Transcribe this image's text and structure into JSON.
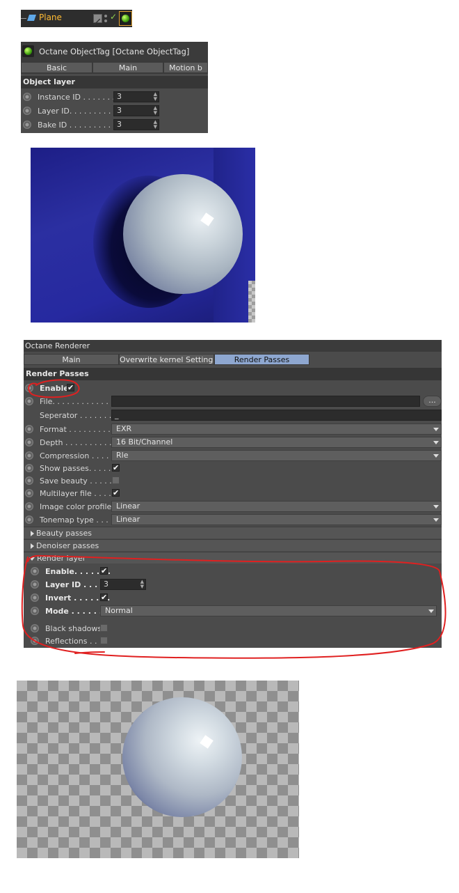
{
  "object_manager": {
    "object_name": "Plane",
    "icons": [
      "plane-icon",
      "phong-tag-icon",
      "visibility-dots-icon",
      "enabled-check-icon",
      "octane-tag-icon"
    ],
    "check_glyph": "✓"
  },
  "object_tag": {
    "title": "Octane ObjectTag [Octane ObjectTag]",
    "tabs": [
      "Basic",
      "Main",
      "Motion b"
    ],
    "section": "Object layer",
    "fields": [
      {
        "label": "Instance ID . . . . . . . .",
        "value": "3"
      },
      {
        "label": "Layer ID. . . . . . . . . . .",
        "value": "3"
      },
      {
        "label": "Bake ID . . . . . . . . . . .",
        "value": "3"
      }
    ]
  },
  "octane_renderer": {
    "title": "Octane Renderer",
    "tabs": [
      "Main",
      "Overwrite kernel Settings",
      "Render Passes"
    ],
    "active_tab": "Render Passes",
    "section": "Render Passes",
    "enable_label": "Enable",
    "file_label": "File. . . . . . . . . . . . . .",
    "file_value": "",
    "file_button": "...",
    "separator_label": "Seperator . . . . . . . .",
    "separator_value": "_",
    "format_label": "Format . . . . . . . . . . .",
    "format_value": "EXR",
    "depth_label": "Depth . . . . . . . . . . . .",
    "depth_value": "16 Bit/Channel",
    "compression_label": "Compression . . . . . .",
    "compression_value": "Rle",
    "show_passes_label": "Show passes. . . . . .",
    "save_beauty_label": "Save beauty . . . . . .",
    "multilayer_label": "Multilayer file . . . . .",
    "color_profile_label": "Image color profile",
    "color_profile_value": "Linear",
    "tonemap_label": "Tonemap type . . . .",
    "tonemap_value": "Linear",
    "groups": {
      "beauty": "Beauty passes",
      "denoiser": "Denoiser passes",
      "render_layer": "Render layer"
    },
    "render_layer": {
      "enable_label": "Enable. . . . . . .",
      "layer_id_label": "Layer ID . . . . .",
      "layer_id_value": "3",
      "invert_label": "Invert . . . . . . .",
      "mode_label": "Mode . . . . . . . .",
      "mode_value": "Normal",
      "black_shadows_label": "Black shadows",
      "reflections_label": "Reflections . . ."
    },
    "check_glyph": "✔"
  },
  "annotation_color": "#e02020"
}
